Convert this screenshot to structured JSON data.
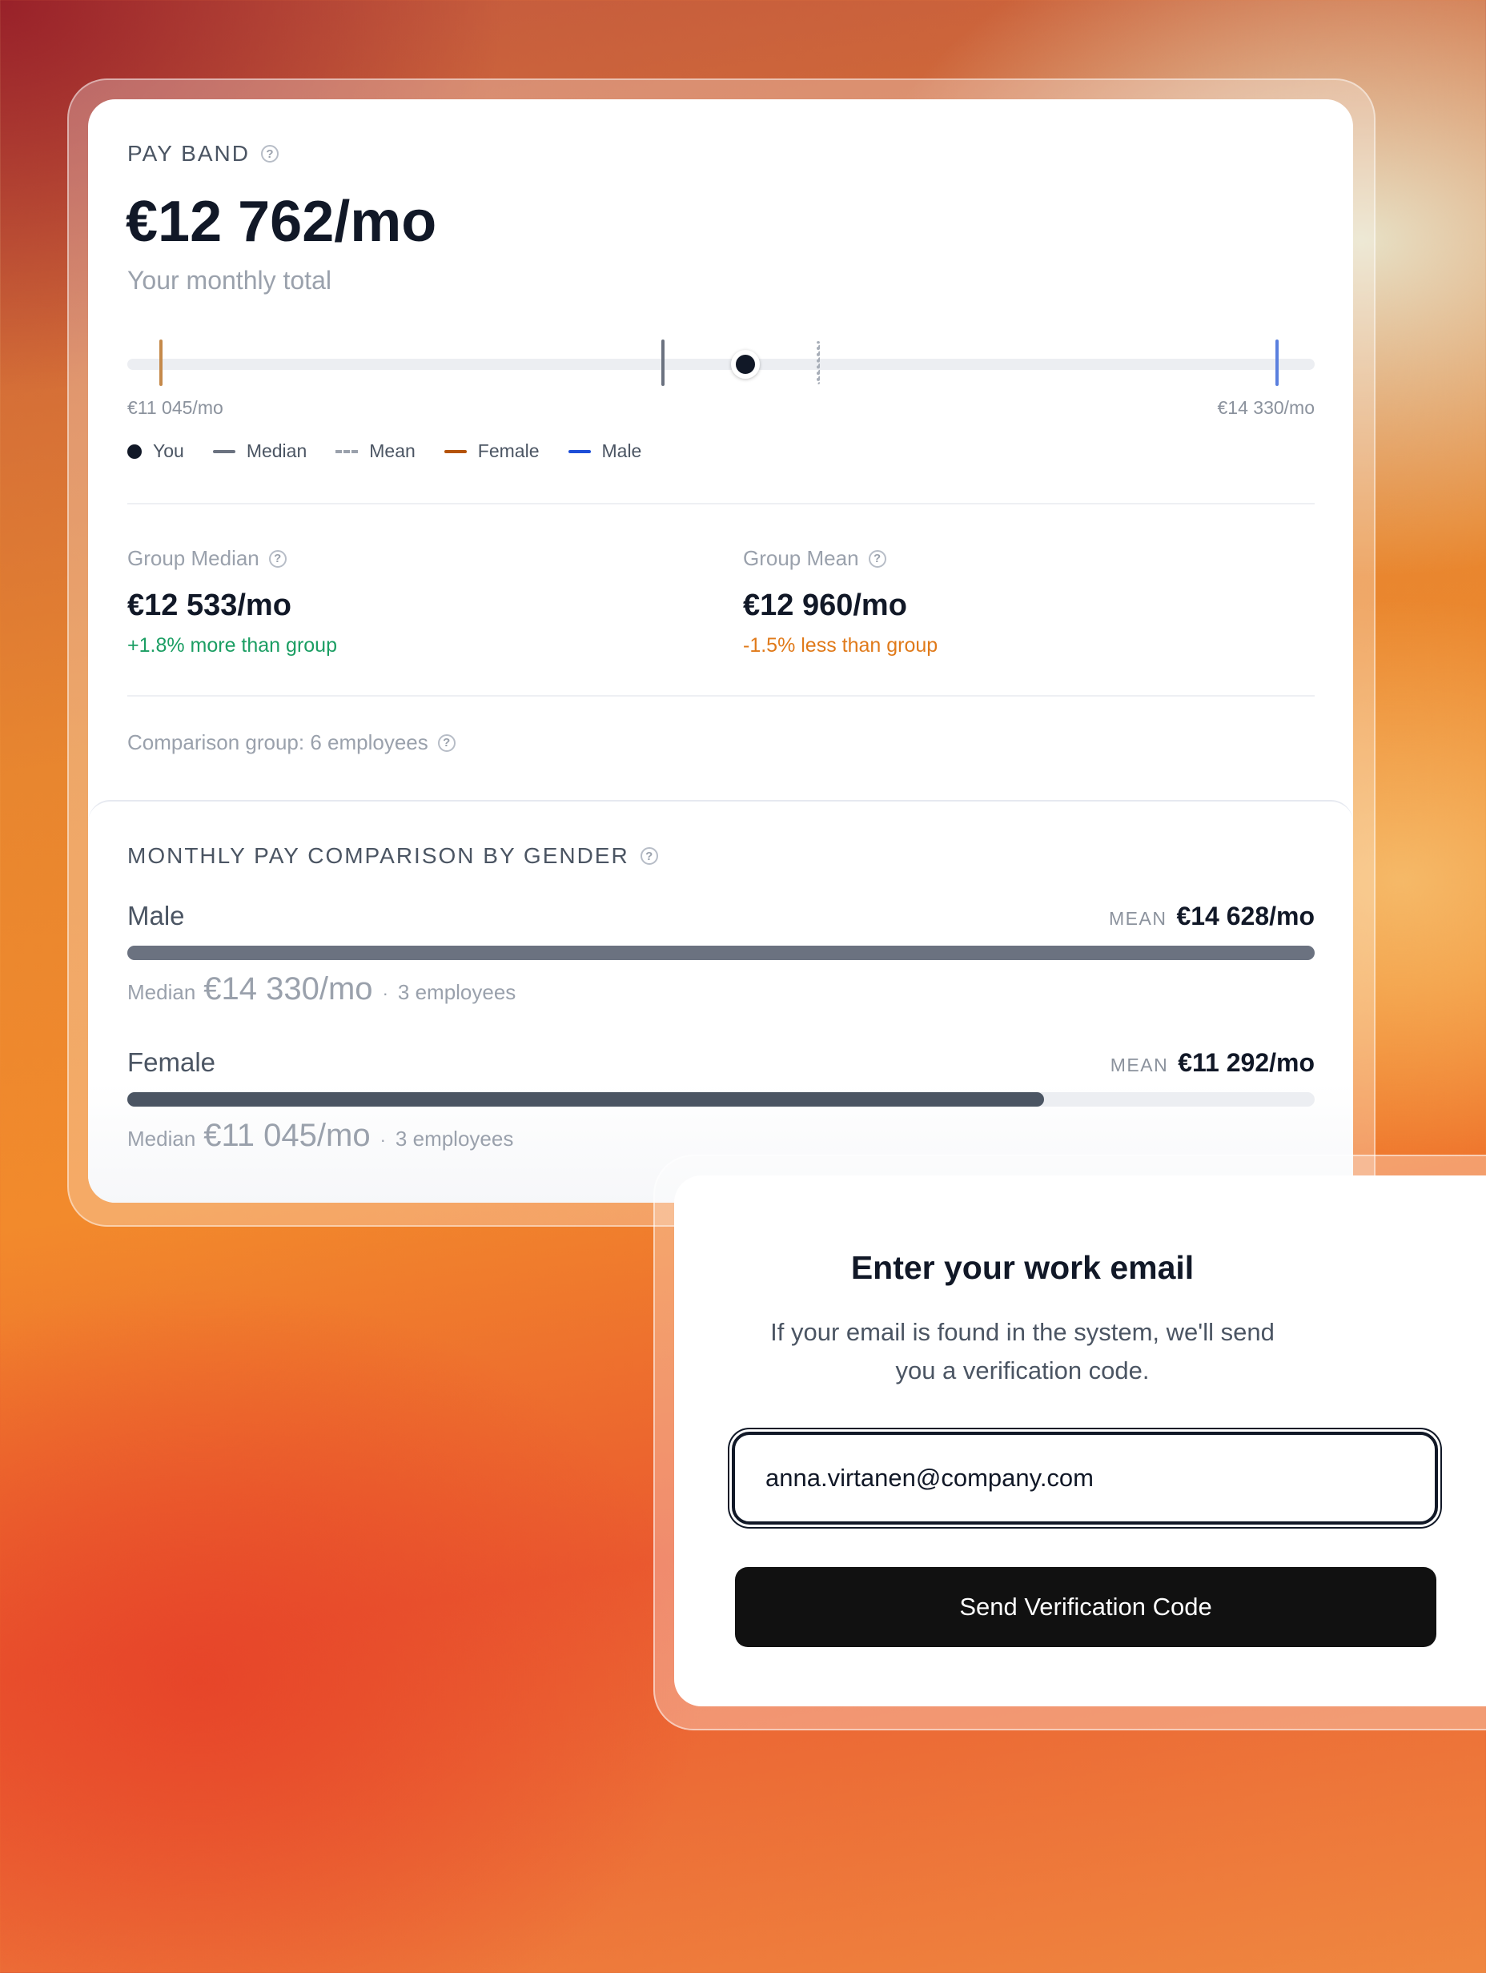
{
  "pay_band": {
    "heading": "PAY BAND",
    "amount": "€12 762/mo",
    "caption": "Your monthly total",
    "range_min": "€11 045/mo",
    "range_max": "€14 330/mo",
    "legend": {
      "you": "You",
      "median": "Median",
      "mean": "Mean",
      "female": "Female",
      "male": "Male"
    },
    "group_median": {
      "label": "Group Median",
      "value": "€12 533/mo",
      "diff": "+1.8% more than group"
    },
    "group_mean": {
      "label": "Group Mean",
      "value": "€12 960/mo",
      "diff": "-1.5% less than group"
    },
    "comparison_note": "Comparison group: 6 employees",
    "colors": {
      "you": "#111827",
      "median": "#6b7280",
      "female": "#b45309",
      "male": "#1d4ed8"
    }
  },
  "gender_comparison": {
    "heading": "MONTHLY PAY COMPARISON BY GENDER",
    "rows": [
      {
        "name": "Male",
        "mean_caption": "MEAN",
        "mean_value": "€14 628/mo",
        "median_label": "Median",
        "median_value": "€14 330/mo",
        "separator": "·",
        "count": "3 employees",
        "bar_fraction": 1.0,
        "bar_color": "#6b7280"
      },
      {
        "name": "Female",
        "mean_caption": "MEAN",
        "mean_value": "€11 292/mo",
        "median_label": "Median",
        "median_value": "€11 045/mo",
        "separator": "·",
        "count": "3 employees",
        "bar_fraction": 0.772,
        "bar_color": "#4b5563"
      }
    ]
  },
  "email_dialog": {
    "title": "Enter your work email",
    "description": "If your email is found in the system, we'll send you a verification code.",
    "email_value": "anna.virtanen@company.com",
    "button_label": "Send Verification Code"
  },
  "icons": {
    "help": "question-circle-icon"
  }
}
